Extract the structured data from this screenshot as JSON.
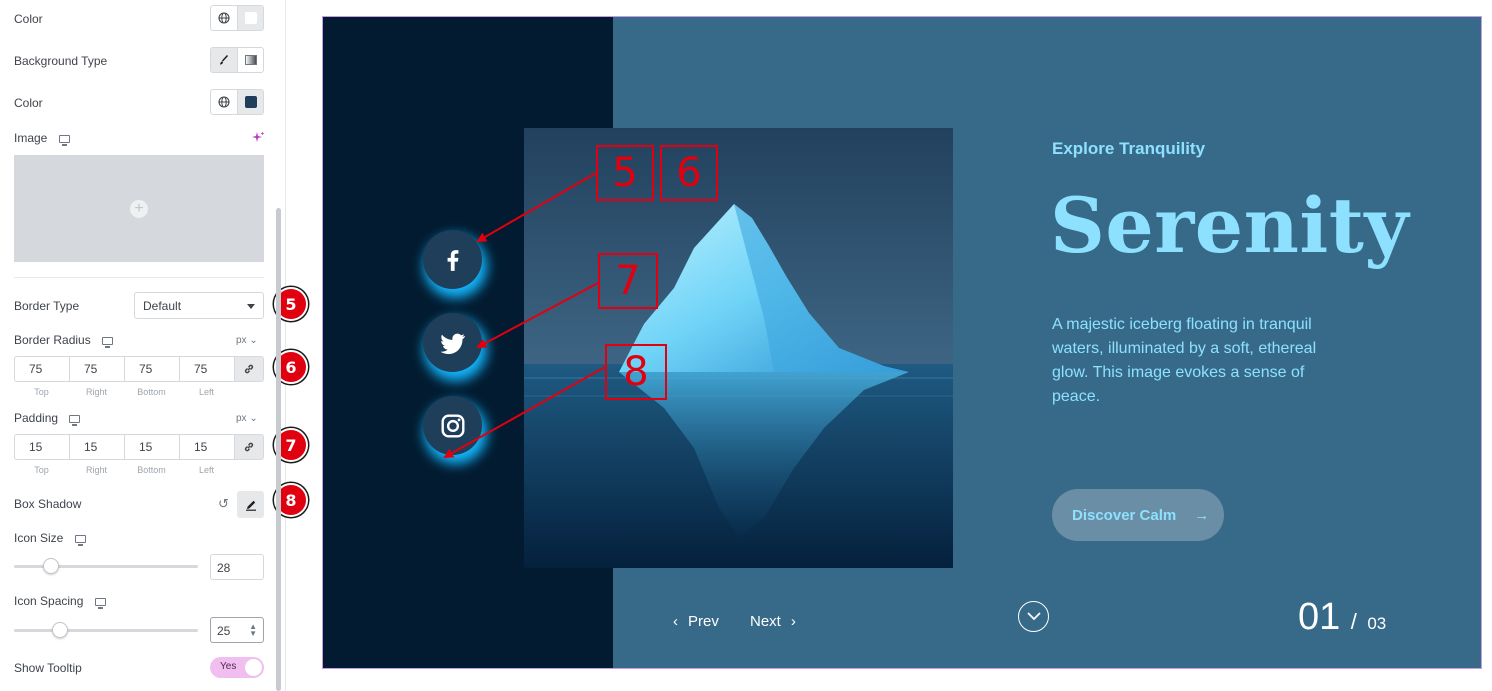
{
  "panel": {
    "color_label_1": "Color",
    "bg_type_label": "Background Type",
    "color_label_2": "Color",
    "image_label": "Image",
    "border_type": {
      "label": "Border Type",
      "value": "Default"
    },
    "border_radius": {
      "label": "Border Radius",
      "unit": "px",
      "values": [
        "75",
        "75",
        "75",
        "75"
      ],
      "sides": [
        "Top",
        "Right",
        "Bottom",
        "Left"
      ]
    },
    "padding": {
      "label": "Padding",
      "unit": "px",
      "values": [
        "15",
        "15",
        "15",
        "15"
      ],
      "sides": [
        "Top",
        "Right",
        "Bottom",
        "Left"
      ]
    },
    "box_shadow_label": "Box Shadow",
    "icon_size": {
      "label": "Icon Size",
      "value": "28",
      "level": 0.2
    },
    "icon_spacing": {
      "label": "Icon Spacing",
      "value": "25",
      "level": 0.25
    },
    "show_tooltip": {
      "label": "Show Tooltip",
      "value": "Yes"
    },
    "badges": [
      "5",
      "6",
      "7",
      "8"
    ]
  },
  "preview": {
    "eyebrow": "Explore Tranquility",
    "title": "Serenity",
    "description": "A majestic iceberg floating in tranquil waters, illuminated by a soft, ethereal glow. This image evokes a sense of peace.",
    "cta": "Discover Calm",
    "prev": "Prev",
    "next": "Next",
    "current_slide": "01",
    "separator": "/",
    "total_slides": "03",
    "annotations": [
      "5",
      "6",
      "7",
      "8"
    ],
    "social_icons": [
      "facebook-icon",
      "twitter-icon",
      "instagram-icon"
    ]
  },
  "colors": {
    "accent": "#8ee0ff",
    "dark": "#031b30",
    "slide_bg": "#376a89",
    "annotation_red": "#e1000f",
    "toggle_pink": "#f0bff0"
  }
}
